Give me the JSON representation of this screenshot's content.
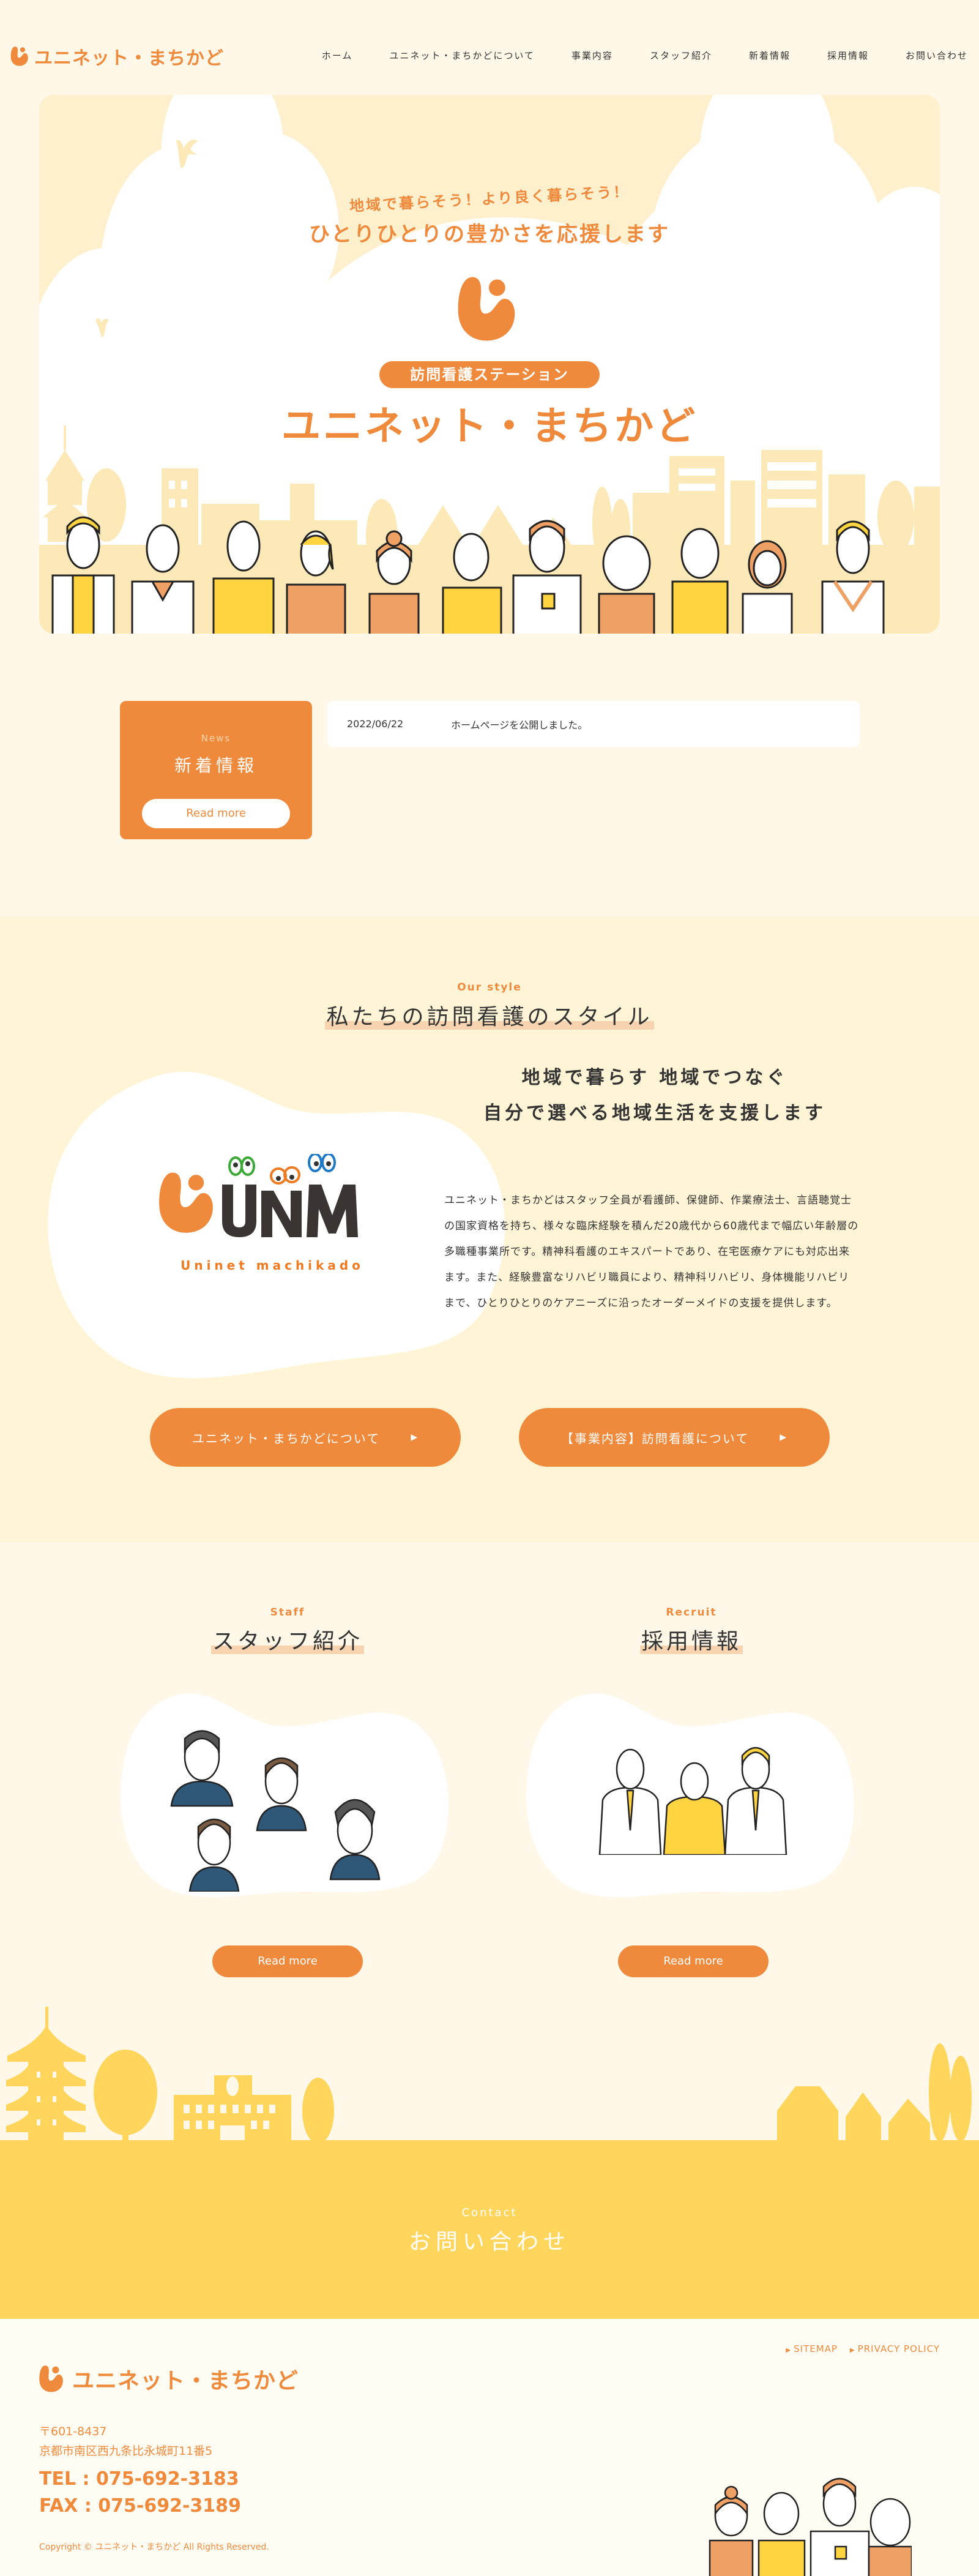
{
  "brand": {
    "name": "ユニネット・まちかど",
    "accent": "#ef8a3c",
    "yellow": "#ffd55c",
    "cream": "#fff8e8"
  },
  "nav": {
    "items": [
      {
        "label": "ホーム"
      },
      {
        "label": "ユニネット・まちかどについて"
      },
      {
        "label": "事業内容"
      },
      {
        "label": "スタッフ紹介"
      },
      {
        "label": "新着情報"
      },
      {
        "label": "採用情報"
      },
      {
        "label": "お問い合わせ"
      }
    ]
  },
  "hero": {
    "tagline1": "地域で暮らそう！より良く暮らそう！",
    "tagline2": "ひとりひとりの豊かさを応援します",
    "station": "訪問看護ステーション",
    "name": "ユニネット・まちかど"
  },
  "news": {
    "en": "News",
    "title": "新着情報",
    "read_more": "Read more",
    "items": [
      {
        "date": "2022/06/22",
        "text": "ホームページを公開しました。"
      }
    ]
  },
  "style": {
    "en": "Our style",
    "title": "私たちの訪問看護のスタイル",
    "logo_caption": "Uninet machikado",
    "heading_line1": "地域で暮らす 地域でつなぐ",
    "heading_line2": "自分で選べる地域生活を支援します",
    "body": "ユニネット・まちかどはスタッフ全員が看護師、保健師、作業療法士、言語聴覚士の国家資格を持ち、様々な臨床経験を積んだ20歳代から60歳代まで幅広い年齢層の多職種事業所です。精神科看護のエキスパートであり、在宅医療ケアにも対応出来ます。また、経験豊富なリハビリ職員により、精神科リハビリ、身体機能リハビリまで、ひとりひとりのケアニーズに沿ったオーダーメイドの支援を提供します。",
    "buttons": [
      {
        "label": "ユニネット・まちかどについて",
        "arrow": "▶"
      },
      {
        "label": "【事業内容】訪問看護について",
        "arrow": "▶"
      }
    ]
  },
  "staff": {
    "en": "Staff",
    "title": "スタッフ紹介",
    "read_more": "Read more"
  },
  "recruit": {
    "en": "Recruit",
    "title": "採用情報",
    "read_more": "Read more"
  },
  "contact": {
    "en": "Contact",
    "title": "お問い合わせ"
  },
  "footer": {
    "postal": "〒601-8437",
    "address": "京都市南区西九条比永城町11番5",
    "tel": "TEL : 075-692-3183",
    "fax": "FAX : 075-692-3189",
    "copyright": "Copyright © ユニネット・まちかど All Rights Reserved.",
    "links": [
      {
        "label": "SITEMAP"
      },
      {
        "label": "PRIVACY POLICY"
      }
    ]
  }
}
